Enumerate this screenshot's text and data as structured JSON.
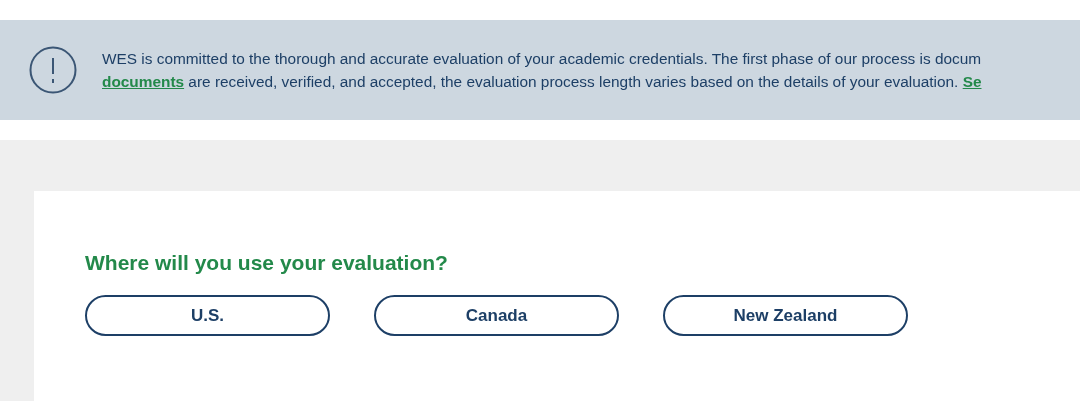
{
  "notice": {
    "text_line_1": "WES is committed to the thorough and accurate evaluation of your academic credentials. The first phase of our process is docum",
    "link_1": "documents",
    "text_line_2": " are received, verified, and accepted, the evaluation process length varies based on the details of your evaluation. ",
    "link_2": "Se"
  },
  "question": {
    "title": "Where will you use your evaluation?",
    "options": [
      {
        "label": "U.S."
      },
      {
        "label": "Canada"
      },
      {
        "label": "New Zealand"
      }
    ]
  }
}
